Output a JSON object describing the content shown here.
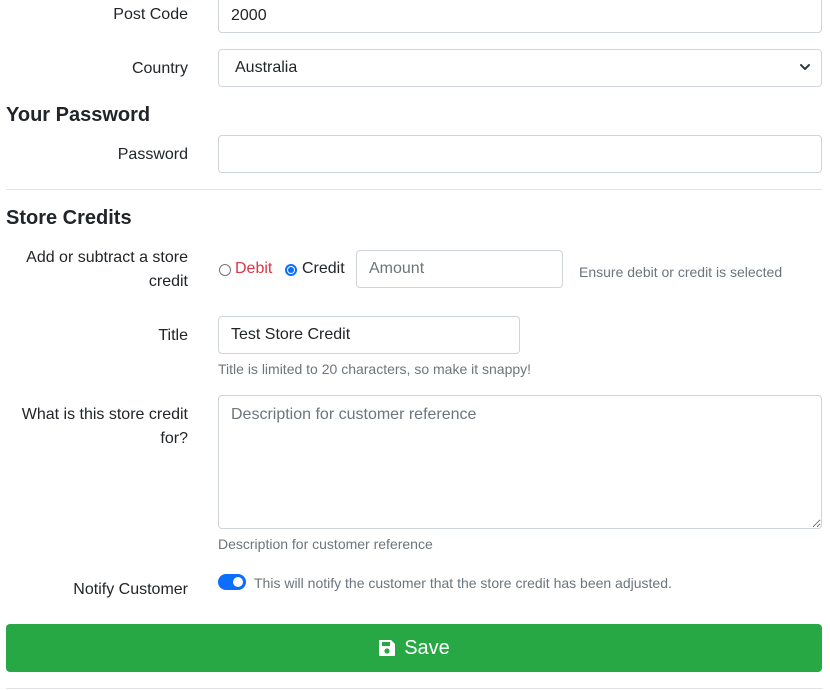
{
  "address": {
    "post_code_label": "Post Code",
    "post_code_value": "2000",
    "country_label": "Country",
    "country_value": "Australia"
  },
  "password_section": {
    "title": "Your Password",
    "password_label": "Password",
    "password_value": ""
  },
  "store_credits": {
    "title": "Store Credits",
    "adjust_label": "Add or subtract a store credit",
    "debit_label": "Debit",
    "credit_label": "Credit",
    "selected": "Credit",
    "amount_placeholder": "Amount",
    "amount_help": "Ensure debit or credit is selected",
    "title_label": "Title",
    "title_value": "Test Store Credit",
    "title_help": "Title is limited to 20 characters, so make it snappy!",
    "description_label": "What is this store credit for?",
    "description_placeholder": "Description for customer reference",
    "description_help": "Description for customer reference",
    "notify_label": "Notify Customer",
    "notify_enabled": true,
    "notify_help": "This will notify the customer that the store credit has been adjusted."
  },
  "actions": {
    "save_label": "Save",
    "save_icon": "floppy-disk-icon"
  },
  "colors": {
    "primary": "#0d6efd",
    "success": "#28a745",
    "debit_text": "#dc3545",
    "muted": "#6c757d",
    "border": "#ced4da"
  }
}
